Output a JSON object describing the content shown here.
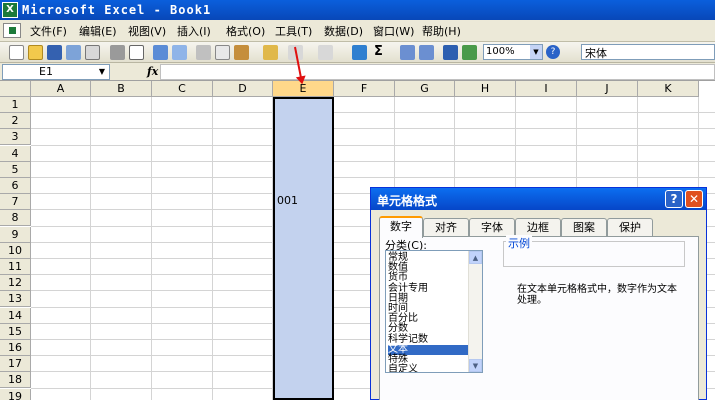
{
  "window": {
    "title": "Microsoft Excel - Book1",
    "app_icon": "excel-icon"
  },
  "menu": [
    "文件(F)",
    "编辑(E)",
    "视图(V)",
    "插入(I)",
    "格式(O)",
    "工具(T)",
    "数据(D)",
    "窗口(W)",
    "帮助(H)"
  ],
  "toolbar": {
    "zoom": "100%",
    "font": "宋体",
    "sum_symbol": "Σ",
    "zoom_arrow": "▼",
    "help_symbol": "?"
  },
  "formula_bar": {
    "name_box": "E1",
    "name_box_arrow": "▼",
    "fx": "fx",
    "content": ""
  },
  "columns": [
    "A",
    "B",
    "C",
    "D",
    "E",
    "F",
    "G",
    "H",
    "I",
    "J",
    "K"
  ],
  "rows": [
    "1",
    "2",
    "3",
    "4",
    "5",
    "6",
    "7",
    "8",
    "9",
    "10",
    "11",
    "12",
    "13",
    "14",
    "15",
    "16",
    "17",
    "18",
    "19"
  ],
  "selected_column": "E",
  "cell_e7": "001",
  "dialog": {
    "title": "单元格格式",
    "help_button": "?",
    "close_button": "✕",
    "tabs": [
      "数字",
      "对齐",
      "字体",
      "边框",
      "图案",
      "保护"
    ],
    "active_tab": "数字",
    "category_label": "分类(C):",
    "categories": [
      "常规",
      "数值",
      "货币",
      "会计专用",
      "日期",
      "时间",
      "百分比",
      "分数",
      "科学记数",
      "文本",
      "特殊",
      "自定义"
    ],
    "selected_category": "文本",
    "sample_label": "示例",
    "description": "在文本单元格格式中，数字作为文本处理。",
    "scroll_up": "▲",
    "scroll_down": "▼"
  },
  "colors": {
    "title_bar": "#0a5fdc",
    "selection": "#c3d2ee",
    "annotation_arrow": "#e01010",
    "list_highlight": "#316ac5"
  }
}
